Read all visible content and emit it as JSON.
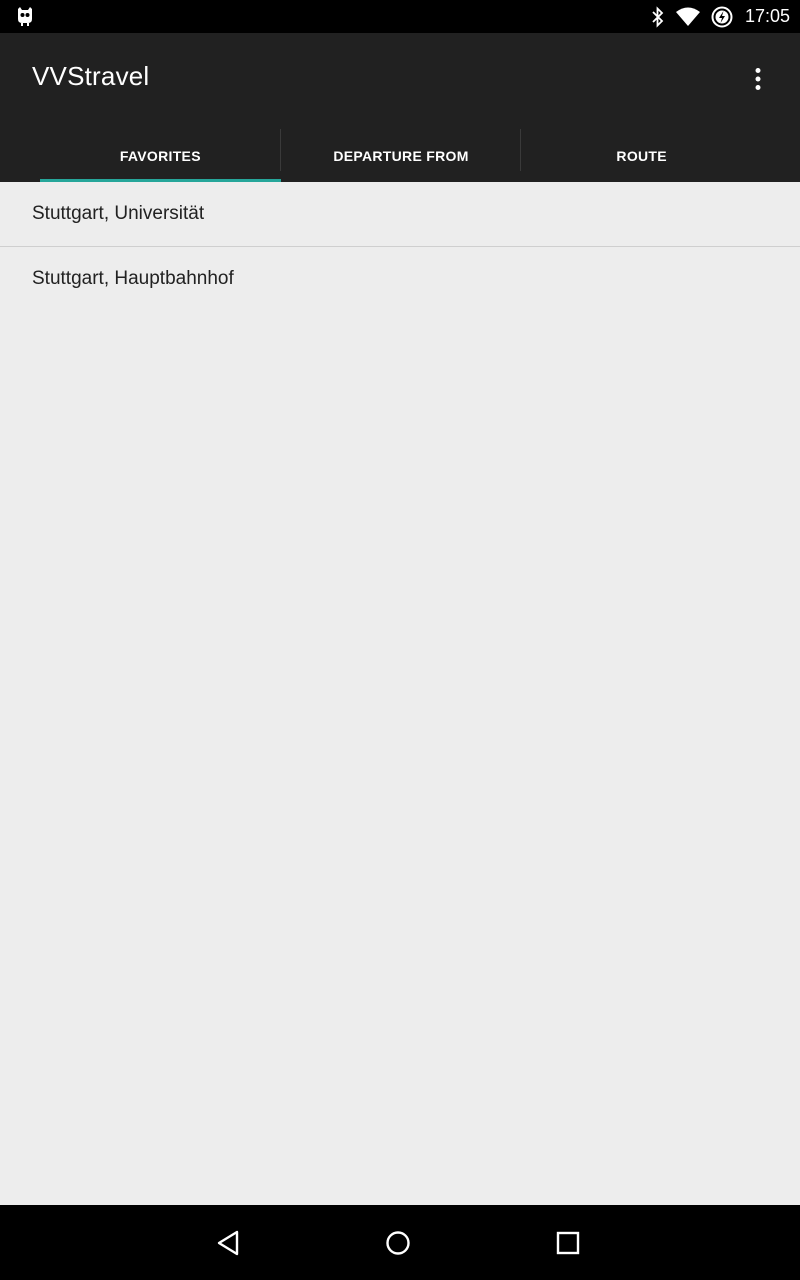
{
  "status_bar": {
    "time": "17:05",
    "icons": [
      "cyanogen-bug-icon",
      "bluetooth-icon",
      "wifi-icon",
      "battery-charging-icon"
    ]
  },
  "app_bar": {
    "title": "VVStravel",
    "overflow_icon": "more-vert-icon"
  },
  "tabs": [
    {
      "label": "FAVORITES",
      "selected": true
    },
    {
      "label": "DEPARTURE FROM",
      "selected": false
    },
    {
      "label": "ROUTE",
      "selected": false
    }
  ],
  "favorites": [
    {
      "label": "Stuttgart, Universität"
    },
    {
      "label": "Stuttgart, Hauptbahnhof"
    }
  ],
  "nav_bar": {
    "icons": [
      "back-icon",
      "home-icon",
      "recents-icon"
    ]
  },
  "colors": {
    "app_bar": "#212121",
    "tab_indicator": "#26a69a",
    "content_bg": "#ededed"
  }
}
